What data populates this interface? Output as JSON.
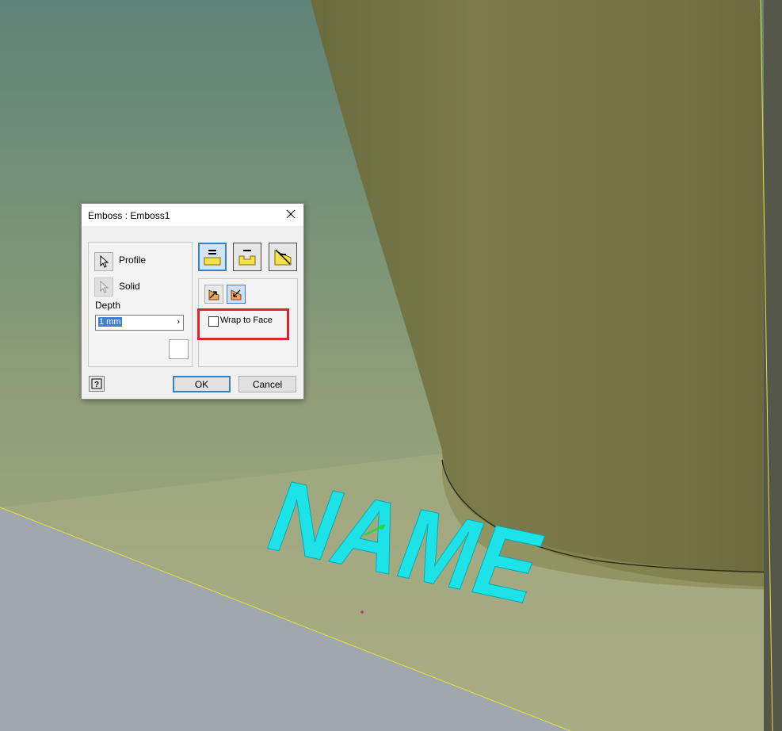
{
  "viewport": {
    "emboss_text": "NAME",
    "text_color": "#1de2e8"
  },
  "dialog": {
    "title": "Emboss : Emboss1",
    "profile_label": "Profile",
    "solid_label": "Solid",
    "depth_label": "Depth",
    "depth_value": "1 mm",
    "wrap_label": "Wrap to Face",
    "wrap_checked": false,
    "ok_label": "OK",
    "cancel_label": "Cancel"
  },
  "colors": {
    "highlight_box": "#e0222d",
    "accent": "#3c7fc0"
  }
}
